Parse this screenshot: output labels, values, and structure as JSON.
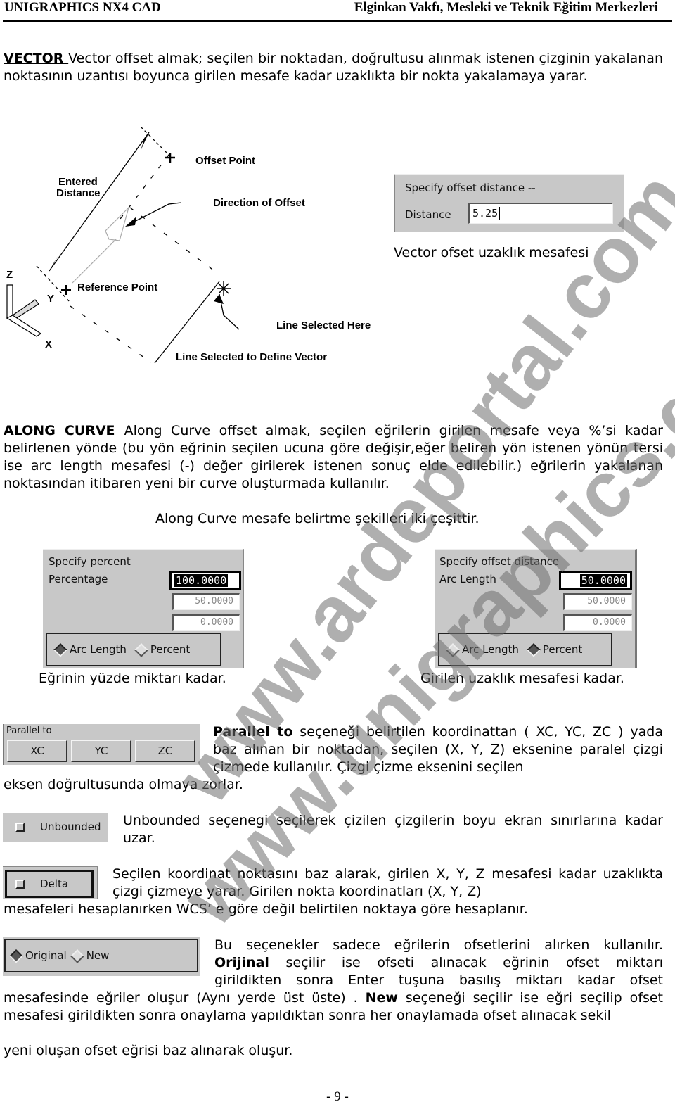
{
  "header": {
    "left": "UNIGRAPHICS NX4 CAD",
    "right": "Elginkan Vakfı, Mesleki ve Teknik Eğitim Merkezleri"
  },
  "vector": {
    "keyword": "VECTOR ",
    "text": " Vector offset almak; seçilen bir noktadan, doğrultusu alınmak istenen  çizginin yakalanan noktasının uzantısı boyunca girilen mesafe kadar uzaklıkta bir nokta yakalamaya yarar.",
    "diagram": {
      "offset_point": "Offset Point",
      "entered_distance_1": "Entered",
      "entered_distance_2": "Distance",
      "direction_of_offset": "Direction of Offset",
      "reference_point": "Reference Point",
      "line_selected_here": "Line Selected Here",
      "line_define_vector": "Line Selected to Define Vector",
      "axis_z": "Z",
      "axis_y": "Y",
      "axis_x": "X"
    },
    "dialog": {
      "prompt": "Specify offset distance --",
      "label": "Distance",
      "value": "5.25"
    },
    "caption": "Vector ofset uzaklık mesafesi"
  },
  "along_curve": {
    "keyword": "ALONG CURVE    ",
    "text": "  Along Curve offset almak, seçilen eğrilerin girilen mesafe veya %’si kadar belirlenen yönde (bu yön eğrinin seçilen ucuna göre değişir,eğer beliren yön istenen yönün tersi ise arc length mesafesi (-) değer girilerek istenen sonuç elde edilebilir.) eğrilerin yakalanan noktasından itibaren yeni bir curve oluşturmada kullanılır.",
    "subtitle": "Along Curve mesafe belirtme şekilleri iki çeşittir.",
    "percent_dialog": {
      "prompt": "Specify percent",
      "label": "Percentage",
      "value": "100.0000",
      "max": "50.0000",
      "min": "0.0000",
      "options": [
        "Arc Length",
        "Percent"
      ],
      "selected": "Arc Length",
      "caption": "Eğrinin yüzde miktarı kadar."
    },
    "distance_dialog": {
      "prompt": "Specify offset distance",
      "label": "Arc Length",
      "value": "50.0000",
      "max": "50.0000",
      "min": "0.0000",
      "options": [
        "Arc Length",
        "Percent"
      ],
      "selected": "Percent",
      "caption": "Girilen uzaklık mesafesi kadar."
    }
  },
  "parallel": {
    "panel_title": "Parallel to",
    "buttons": [
      "XC",
      "YC",
      "ZC"
    ],
    "keyword": "Parallel to",
    "text": " seçeneği belirtilen koordinattan ( XC, YC, ZC ) yada baz alınan bir noktadan, seçilen (X, Y, Z) eksenine paralel çizgi çizmede kullanılır. Çizgi çizme eksenini seçilen",
    "text_cont": "eksen doğrultusunda olmaya zorlar."
  },
  "unbounded": {
    "button": "Unbounded",
    "text": "Unbounded seçenegi seçilerek çizilen çizgilerin boyu ekran sınırlarına kadar uzar."
  },
  "delta": {
    "button": "Delta",
    "text": "Seçilen koordinat noktasını baz alarak, girilen X, Y, Z mesafesi kadar uzaklıkta çizgi çizmeye yarar. Girilen nokta koordinatları (X, Y, Z)",
    "text_cont": "mesafeleri hesaplanırken WCS’ e göre değil belirtilen noktaya göre hesaplanır."
  },
  "orig_new": {
    "options": [
      "Original",
      "New"
    ],
    "selected": "Original",
    "line1": "Bu seçenekler sadece eğrilerin ofsetlerini alırken kullanılır.",
    "kw_orijinal": "Orijinal",
    "line2": " seçilir ise ofseti alınacak eğrinin ofset miktarı",
    "line3": "girildikten sonra Enter tuşuna basılış miktarı kadar ofset",
    "line4a": "mesafesinde eğriler oluşur (Aynı yerde üst üste) . ",
    "kw_new": "New",
    "line4b": " seçeneği seçilir ise eğri seçilip ofset mesafesi girildikten sonra onaylama yapıldıktan sonra her onaylamada ofset alınacak sekil",
    "line5": "yeni oluşan ofset eğrisi baz alınarak oluşur."
  },
  "footer": {
    "page": "- 9 -"
  },
  "watermarks": [
    "www.ardeportal.com",
    "www.unigraphics.gen.tr"
  ]
}
